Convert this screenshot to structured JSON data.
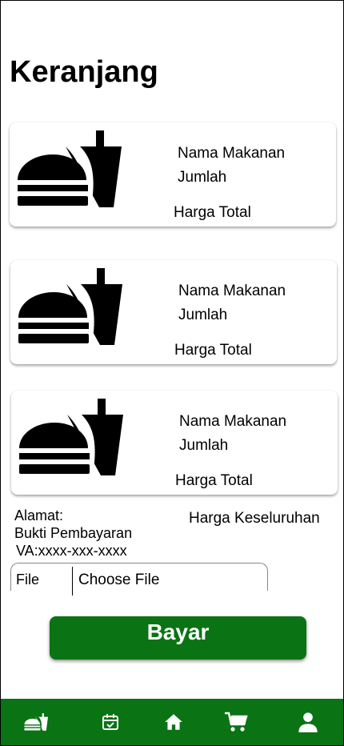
{
  "page": {
    "title": "Keranjang"
  },
  "cart_items": [
    {
      "name": "Nama Makanan",
      "qty": "Jumlah",
      "total": "Harga Total",
      "icon": "fastfood-icon"
    },
    {
      "name": "Nama Makanan",
      "qty": "Jumlah",
      "total": "Harga Total",
      "icon": "fastfood-icon"
    },
    {
      "name": "Nama Makanan",
      "qty": "Jumlah",
      "total": "Harga Total",
      "icon": "fastfood-icon"
    }
  ],
  "checkout": {
    "address_label": "Alamat:",
    "proof_label": "Bukti Pembayaran",
    "va_label": "VA:xxxx-xxx-xxxx",
    "grand_total_label": "Harga Keseluruhan",
    "file_label": "File",
    "file_button": "Choose File",
    "pay_button": "Bayar"
  },
  "bottom_nav": [
    {
      "icon": "fastfood-icon"
    },
    {
      "icon": "calendar-check-icon"
    },
    {
      "icon": "home-icon"
    },
    {
      "icon": "cart-icon"
    },
    {
      "icon": "person-icon"
    }
  ],
  "colors": {
    "accent": "#0a7314",
    "background": "#ffffff",
    "text": "#000000"
  }
}
